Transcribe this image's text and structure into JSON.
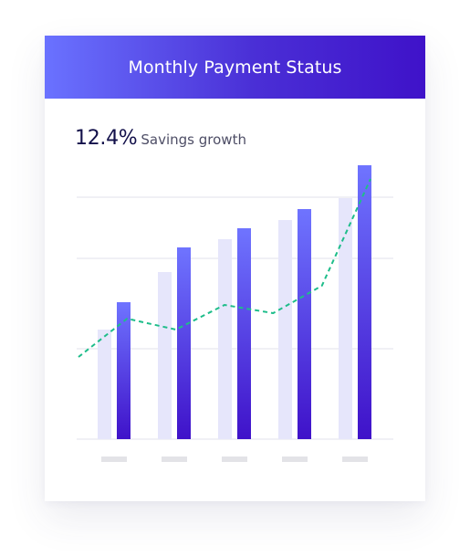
{
  "card": {
    "title": "Monthly Payment Status"
  },
  "metric": {
    "value": "12.4%",
    "label": "Savings growth"
  },
  "colors": {
    "header_start": "#6a72ff",
    "header_end": "#3f12c9",
    "bar_primary_top": "#6f74ff",
    "bar_primary_bottom": "#3f12c9",
    "bar_secondary": "#e6e6fb",
    "trend_line": "#1ebd8a",
    "gridline": "#ececf2",
    "tick_placeholder": "#e3e3e7"
  },
  "chart_data": {
    "type": "bar",
    "categories": [
      "",
      "",
      "",
      "",
      ""
    ],
    "series": [
      {
        "values": [
          40,
          61,
          73,
          80,
          88
        ],
        "style": "light"
      },
      {
        "values": [
          50,
          70,
          77,
          84,
          100
        ],
        "style": "gradient"
      }
    ],
    "trend_line": [
      30,
      44,
      40,
      49,
      46,
      56,
      95
    ],
    "ylim": [
      0,
      100
    ],
    "grid": true,
    "tick_labels_visible": false
  }
}
